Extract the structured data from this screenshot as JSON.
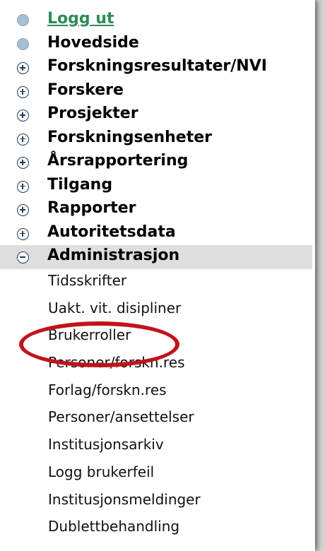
{
  "menu": {
    "items": [
      {
        "label": "Logg ut",
        "marker": "bullet",
        "style": "link"
      },
      {
        "label": "Hovedside",
        "marker": "bullet"
      },
      {
        "label": "Forskningsresultater/NVI",
        "marker": "plus"
      },
      {
        "label": "Forskere",
        "marker": "plus"
      },
      {
        "label": "Prosjekter",
        "marker": "plus"
      },
      {
        "label": "Forskningsenheter",
        "marker": "plus"
      },
      {
        "label": "Årsrapportering",
        "marker": "plus"
      },
      {
        "label": "Tilgang",
        "marker": "plus"
      },
      {
        "label": "Rapporter",
        "marker": "plus"
      },
      {
        "label": "Autoritetsdata",
        "marker": "plus"
      },
      {
        "label": "Administrasjon",
        "marker": "minus",
        "expanded": true
      }
    ],
    "submenu": [
      {
        "label": "Tidsskrifter"
      },
      {
        "label": "Uakt. vit. disipliner"
      },
      {
        "label": "Brukerroller",
        "highlighted": true
      },
      {
        "label": "Personer/forskn.res"
      },
      {
        "label": "Forlag/forskn.res"
      },
      {
        "label": "Personer/ansettelser"
      },
      {
        "label": "Institusjonsarkiv"
      },
      {
        "label": "Logg brukerfeil"
      },
      {
        "label": "Institusjonsmeldinger"
      },
      {
        "label": "Dublettbehandling"
      }
    ]
  },
  "colors": {
    "link": "#2e8b57",
    "active_background": "#dedede",
    "highlight_ellipse": "#c0141b",
    "bullet": "#a9bfd5",
    "toggle_icon": "#1f3b5e"
  },
  "icons": {
    "bullet": "bullet-icon",
    "plus": "expand-plus-icon",
    "minus": "collapse-minus-icon"
  }
}
